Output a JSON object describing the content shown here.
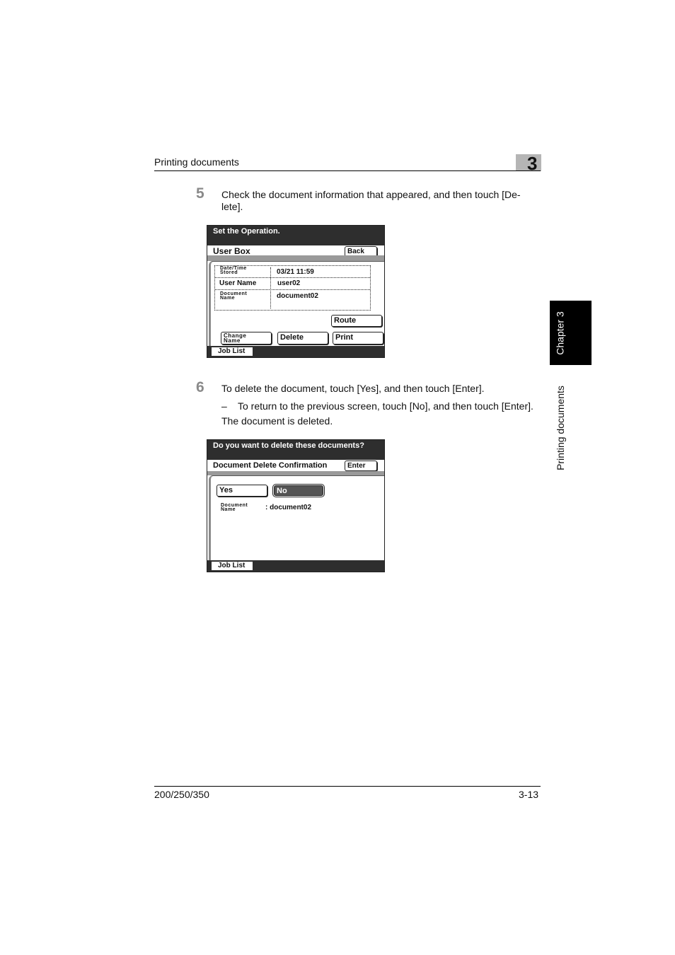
{
  "header": {
    "section_title": "Printing documents",
    "chapter_number": "3"
  },
  "side_tab": {
    "chapter_label": "Chapter 3",
    "section_label": "Printing documents"
  },
  "steps": [
    {
      "number": "5",
      "text_line1": "Check the document information that appeared, and then touch [De-",
      "text_line2": "lete]."
    },
    {
      "number": "6",
      "text": "To delete the document, touch [Yes], and then touch [Enter].",
      "sub_bullet_dash": "–",
      "sub_bullet": "To return to the previous screen, touch [No], and then touch [Enter].",
      "result": "The document is deleted."
    }
  ],
  "screen1": {
    "title": "Set the Operation.",
    "subtitle": "User Box",
    "back_button": "Back",
    "info": {
      "date_label_line1": "Date/Time",
      "date_label_line2": "Stored",
      "date_value": "03/21    11:59",
      "user_label": "User Name",
      "user_value": "user02",
      "doc_label_line1": "Document",
      "doc_label_line2": "Name",
      "doc_value": "document02"
    },
    "buttons": {
      "route": "Route",
      "change_name_line1": "Change",
      "change_name_line2": "Name",
      "delete": "Delete",
      "print": "Print"
    },
    "job_list": "Job List"
  },
  "screen2": {
    "title": "Do you want to delete these documents?",
    "subtitle": "Document Delete Confirmation",
    "enter_button": "Enter",
    "yes_button": "Yes",
    "no_button": "No",
    "doc_label_line1": "Document",
    "doc_label_line2": "Name",
    "doc_value": ": document02",
    "job_list": "Job List"
  },
  "footer": {
    "model": "200/250/350",
    "page": "3-13"
  }
}
